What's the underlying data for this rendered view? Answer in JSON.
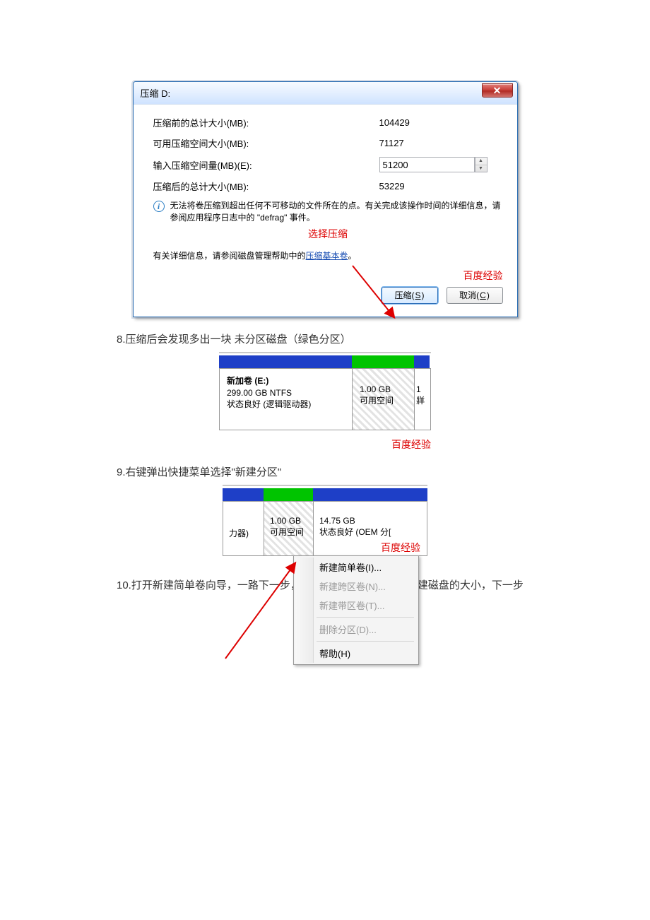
{
  "dialog": {
    "title": "压缩 D:",
    "labels": {
      "total_before": "压缩前的总计大小(MB):",
      "available": "可用压缩空间大小(MB):",
      "input": "输入压缩空间量(MB)(E):",
      "total_after": "压缩后的总计大小(MB):"
    },
    "values": {
      "total_before": "104429",
      "available": "71127",
      "input": "51200",
      "total_after": "53229"
    },
    "info_text": "无法将卷压缩到超出任何不可移动的文件所在的点。有关完成该操作时间的详细信息，请参阅应用程序日志中的 \"defrag\" 事件。",
    "red_label": "选择压缩",
    "help_prefix": "有关详细信息，请参阅磁盘管理帮助中的",
    "help_link": "压缩基本卷",
    "help_suffix": "。",
    "watermark": "百度经验",
    "btn_ok_prefix": "压缩(",
    "btn_ok_key": "S",
    "btn_ok_suffix": ")",
    "btn_cancel_prefix": "取消(",
    "btn_cancel_key": "C",
    "btn_cancel_suffix": ")"
  },
  "step8": "8.压缩后会发现多出一块 未分区磁盘（绿色分区）",
  "diskmap1": {
    "vol1_title": "新加卷  (E:)",
    "vol1_size": "299.00 GB NTFS",
    "vol1_status": "状态良好 (逻辑驱动器)",
    "vol2_size": "1.00 GB",
    "vol2_status": "可用空间",
    "vol3_text": "1",
    "vol3_sub": "牂",
    "footer": "百度经验"
  },
  "step9": "9.右键弹出快捷菜单选择\"新建分区\"",
  "diskmap2": {
    "vol1_text": "力器)",
    "vol2_size": "1.00 GB",
    "vol2_status": "可用空间",
    "vol3_size": "14.75 GB",
    "vol3_status": "状态良好 (OEM 分[",
    "menu": {
      "m1": "新建简单卷(I)...",
      "m2": "新建跨区卷(N)...",
      "m3": "新建带区卷(T)...",
      "m4": "删除分区(D)...",
      "m5": "帮助(H)"
    },
    "footer": "百度经验"
  },
  "step10": "10.打开新建简单卷向导，一路下一步，在简单卷大小里填写要新建磁盘的大小，下一步"
}
